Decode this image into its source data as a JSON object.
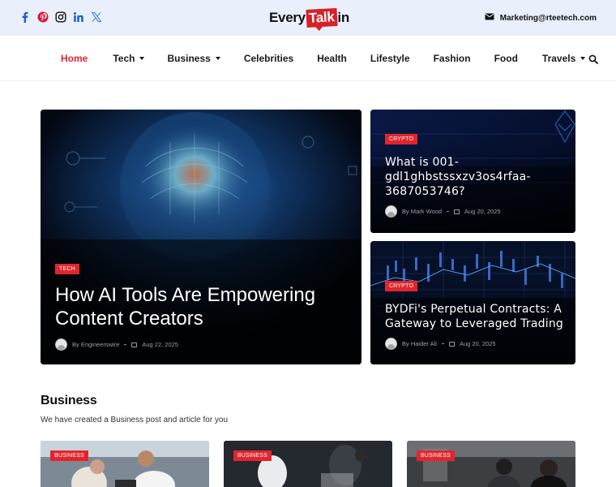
{
  "topbar": {
    "socials": [
      "facebook-icon",
      "pinterest-icon",
      "instagram-icon",
      "linkedin-icon",
      "x-twitter-icon"
    ],
    "logo": {
      "part1": "Every",
      "part2": "Talk",
      "part3": "in"
    },
    "email": "Marketing@rteetech.com"
  },
  "nav": {
    "items": [
      {
        "label": "Home",
        "active": true,
        "dropdown": false
      },
      {
        "label": "Tech",
        "active": false,
        "dropdown": true
      },
      {
        "label": "Business",
        "active": false,
        "dropdown": true
      },
      {
        "label": "Celebrities",
        "active": false,
        "dropdown": false
      },
      {
        "label": "Health",
        "active": false,
        "dropdown": false
      },
      {
        "label": "Lifestyle",
        "active": false,
        "dropdown": false
      },
      {
        "label": "Fashion",
        "active": false,
        "dropdown": false
      },
      {
        "label": "Food",
        "active": false,
        "dropdown": false
      },
      {
        "label": "Travels",
        "active": false,
        "dropdown": true
      }
    ]
  },
  "hero": {
    "main": {
      "tag": "TECH",
      "title": "How AI Tools Are Empowering Content Creators",
      "author": "By Engineerswire",
      "date": "Aug 22, 2025"
    },
    "side": [
      {
        "tag": "CRYPTO",
        "title": "What is 001-gdl1ghbstssxzv3os4rfaa-3687053746?",
        "author": "By Mark Wood",
        "date": "Aug 20, 2025"
      },
      {
        "tag": "CRYPTO",
        "title": "BYDFi's Perpetual Contracts: A Gateway to Leveraged Trading",
        "author": "By Haider Ali",
        "date": "Aug 20, 2025"
      }
    ]
  },
  "section": {
    "title": "Business",
    "subtitle": "We have created a Business post and article for you",
    "cards": [
      {
        "tag": "BUSINESS"
      },
      {
        "tag": "BUSINESS"
      },
      {
        "tag": "BUSINESS"
      }
    ]
  },
  "colors": {
    "accent": "#e2252c",
    "topbar_bg": "#e9effb",
    "social_blue": "#1f5fd4"
  }
}
